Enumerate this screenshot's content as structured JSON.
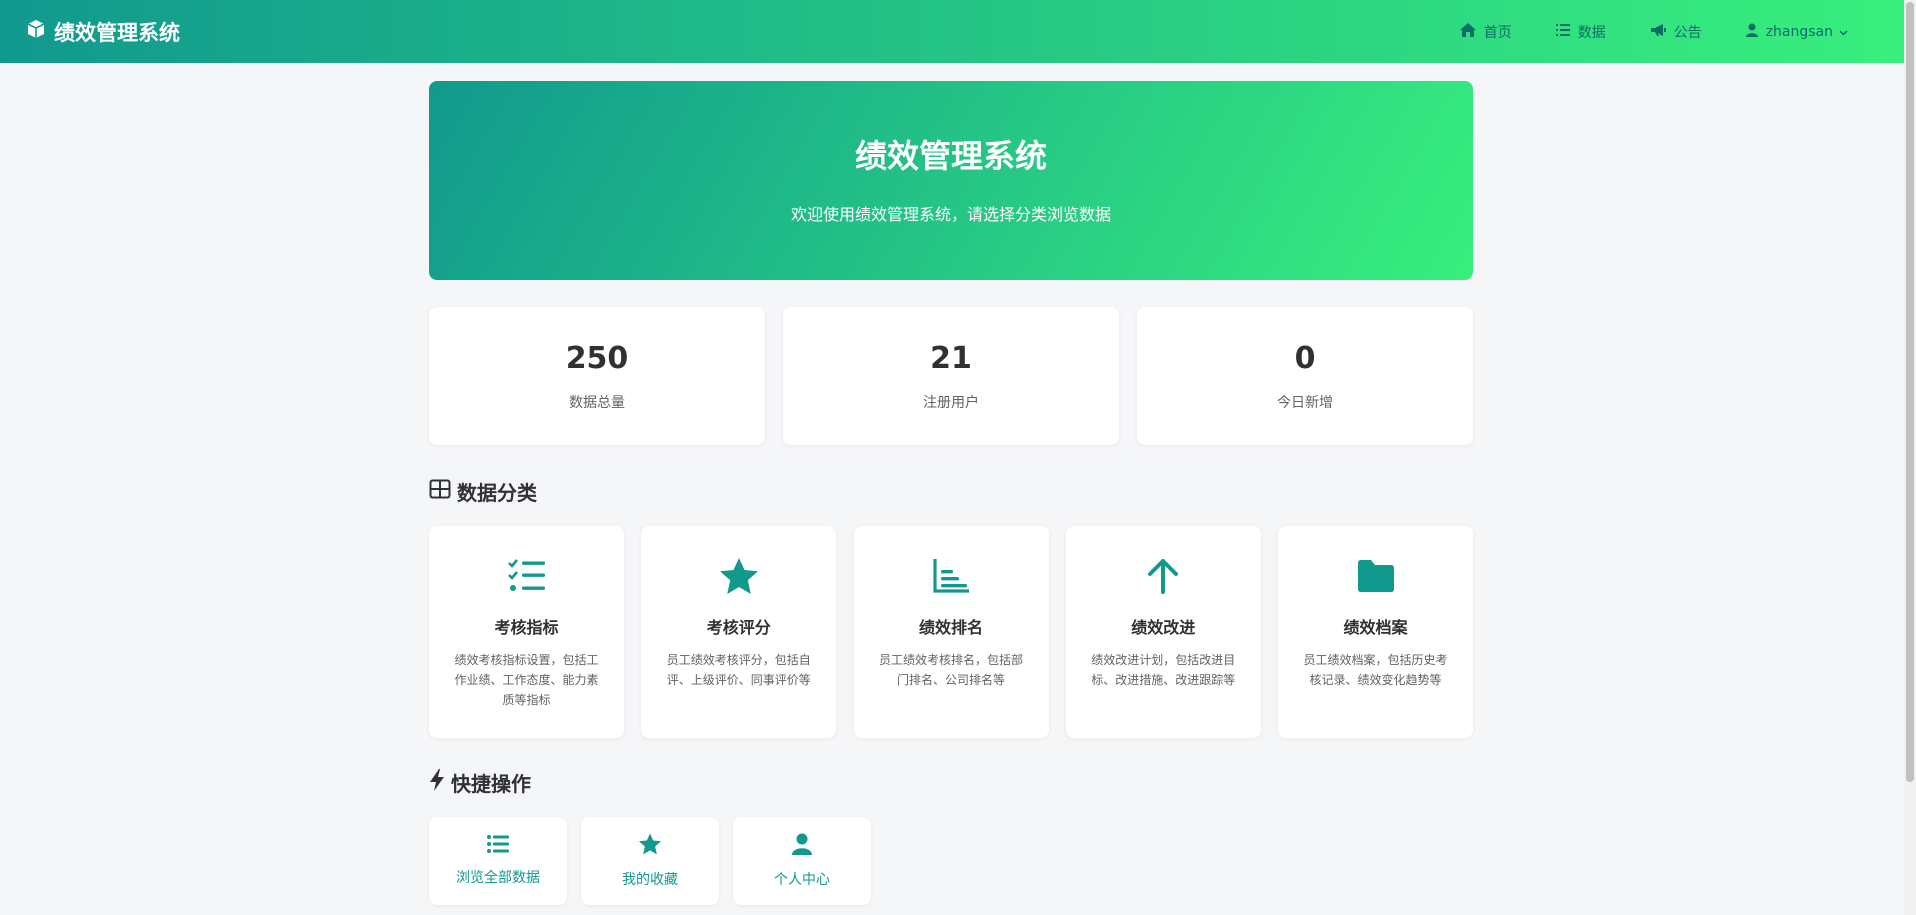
{
  "nav": {
    "brand": "绩效管理系统",
    "links": [
      {
        "label": "首页",
        "icon": "home-icon"
      },
      {
        "label": "数据",
        "icon": "list-icon"
      },
      {
        "label": "公告",
        "icon": "megaphone-icon"
      }
    ],
    "user": "zhangsan"
  },
  "hero": {
    "title": "绩效管理系统",
    "subtitle": "欢迎使用绩效管理系统，请选择分类浏览数据"
  },
  "stats": [
    {
      "value": "250",
      "label": "数据总量"
    },
    {
      "value": "21",
      "label": "注册用户"
    },
    {
      "value": "0",
      "label": "今日新增"
    }
  ],
  "categories_title": "数据分类",
  "categories": [
    {
      "name": "考核指标",
      "desc": "绩效考核指标设置，包括工作业绩、工作态度、能力素质等指标",
      "icon": "checklist-icon"
    },
    {
      "name": "考核评分",
      "desc": "员工绩效考核评分，包括自评、上级评价、同事评价等",
      "icon": "star-icon"
    },
    {
      "name": "绩效排名",
      "desc": "员工绩效考核排名，包括部门排名、公司排名等",
      "icon": "ranking-chart-icon"
    },
    {
      "name": "绩效改进",
      "desc": "绩效改进计划，包括改进目标、改进措施、改进跟踪等",
      "icon": "arrow-up-icon"
    },
    {
      "name": "绩效档案",
      "desc": "员工绩效档案，包括历史考核记录、绩效变化趋势等",
      "icon": "folder-icon"
    }
  ],
  "quick_title": "快捷操作",
  "quick": [
    {
      "label": "浏览全部数据",
      "icon": "list-icon"
    },
    {
      "label": "我的收藏",
      "icon": "star-icon"
    },
    {
      "label": "个人中心",
      "icon": "user-icon"
    }
  ],
  "colors": {
    "accent": "#11998e",
    "gradient_end": "#38ef7d"
  }
}
